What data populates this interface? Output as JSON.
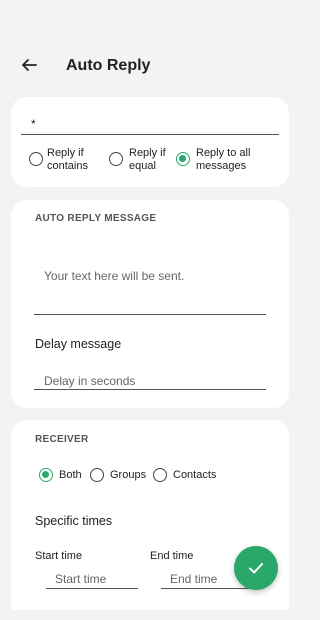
{
  "header": {
    "title": "Auto Reply"
  },
  "keyword_card": {
    "value": "*",
    "options": [
      {
        "label_line1": "Reply if",
        "label_line2": "contains",
        "selected": false
      },
      {
        "label_line1": "Reply if",
        "label_line2": "equal",
        "selected": false
      },
      {
        "label_line1": "Reply to all",
        "label_line2": "messages",
        "selected": true
      }
    ]
  },
  "message_card": {
    "section_title": "AUTO REPLY MESSAGE",
    "message_placeholder": "Your text here will be sent.",
    "delay_label": "Delay message",
    "delay_placeholder": "Delay in seconds"
  },
  "receiver_card": {
    "section_title": "RECEIVER",
    "options": [
      {
        "label": "Both",
        "selected": true
      },
      {
        "label": "Groups",
        "selected": false
      },
      {
        "label": "Contacts",
        "selected": false
      }
    ],
    "specific_times_label": "Specific times",
    "start_time_label": "Start time",
    "start_time_placeholder": "Start time",
    "end_time_label": "End time",
    "end_time_placeholder": "End time"
  },
  "colors": {
    "accent": "#2aa86a",
    "background": "#f3f3f3",
    "card": "#ffffff"
  },
  "icons": {
    "back": "arrow-left",
    "fab": "check"
  }
}
